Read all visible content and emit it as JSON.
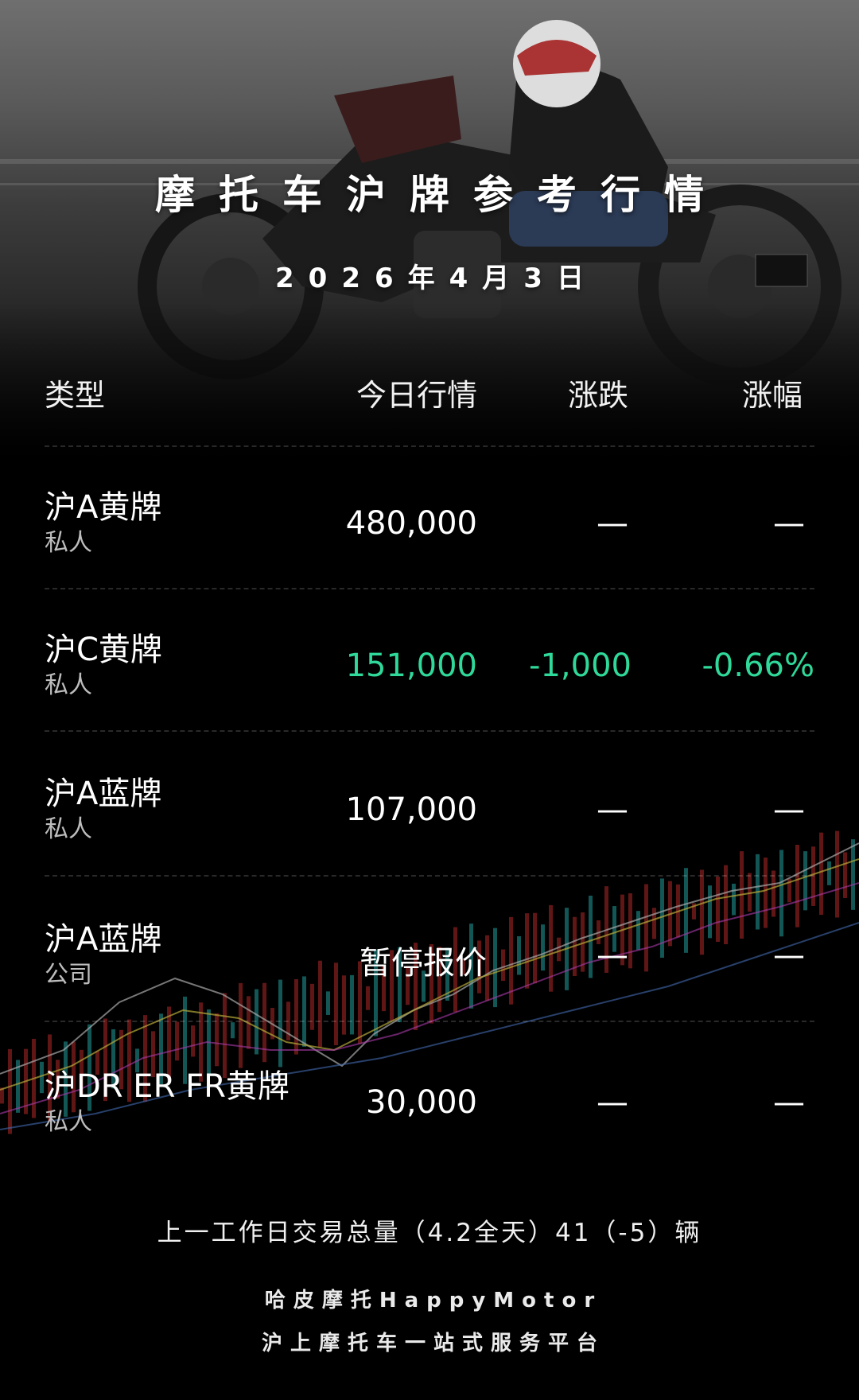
{
  "header": {
    "title": "摩托车沪牌参考行情",
    "date": "2026年4月3日"
  },
  "table": {
    "columns": [
      "类型",
      "今日行情",
      "涨跌",
      "涨幅"
    ],
    "rows": [
      {
        "name": "沪A黄牌",
        "owner": "私人",
        "price": "480,000",
        "change": "—",
        "pct": "—",
        "trend": "flat"
      },
      {
        "name": "沪C黄牌",
        "owner": "私人",
        "price": "151,000",
        "change": "-1,000",
        "pct": "-0.66%",
        "trend": "down"
      },
      {
        "name": "沪A蓝牌",
        "owner": "私人",
        "price": "107,000",
        "change": "—",
        "pct": "—",
        "trend": "flat"
      },
      {
        "name": "沪A蓝牌",
        "owner": "公司",
        "price": "暂停报价",
        "change": "—",
        "pct": "—",
        "trend": "flat"
      },
      {
        "name": "沪DR ER FR黄牌",
        "owner": "私人",
        "price": "30,000",
        "change": "—",
        "pct": "—",
        "trend": "flat"
      }
    ]
  },
  "footer": {
    "summary": "上一工作日交易总量（4.2全天）41（-5）辆",
    "brand_line1": "哈皮摩托HappyMotor",
    "brand_line2": "沪上摩托车一站式服务平台"
  },
  "colors": {
    "down": "#2fd99a",
    "background": "#000000",
    "text": "#ffffff"
  },
  "background_images": {
    "hero": "motorcycle-rider-photo",
    "footer": "candlestick-chart"
  }
}
